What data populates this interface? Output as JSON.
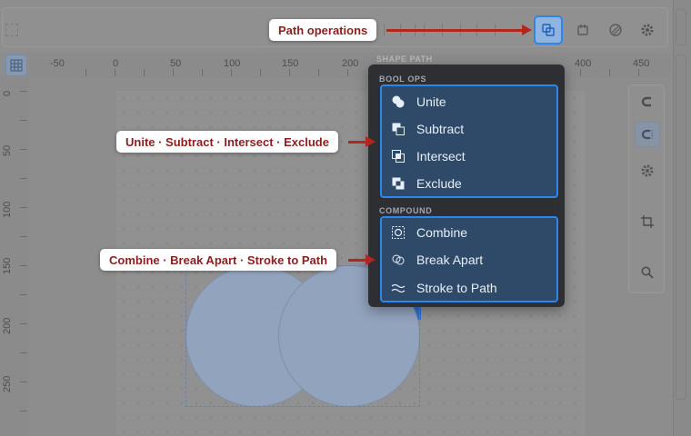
{
  "toolbar": {
    "path_ops_button": {
      "icon": "path-ops-icon",
      "active": true
    },
    "buttons": [
      {
        "icon": "boolean-icon"
      },
      {
        "icon": "image-trace-icon"
      },
      {
        "icon": "gear-icon"
      }
    ]
  },
  "rulers": {
    "horizontal": [
      "-50",
      "0",
      "50",
      "100",
      "150",
      "200",
      "400",
      "450"
    ],
    "vertical": [
      "0",
      "50",
      "100",
      "150",
      "200",
      "250"
    ]
  },
  "menu": {
    "header": "SHAPE PATH",
    "sections": [
      {
        "title": "BOOL OPS",
        "items": [
          {
            "label": "Unite",
            "icon": "unite-icon"
          },
          {
            "label": "Subtract",
            "icon": "subtract-icon"
          },
          {
            "label": "Intersect",
            "icon": "intersect-icon"
          },
          {
            "label": "Exclude",
            "icon": "exclude-icon"
          }
        ]
      },
      {
        "title": "COMPOUND",
        "items": [
          {
            "label": "Combine",
            "icon": "combine-icon"
          },
          {
            "label": "Break Apart",
            "icon": "break-apart-icon"
          },
          {
            "label": "Stroke to Path",
            "icon": "stroke-to-path-icon"
          }
        ]
      }
    ]
  },
  "callouts": {
    "path_operations": "Path operations",
    "bool_ops": "Unite · Subtract · Intersect · Exclude",
    "compound": "Combine · Break Apart · Stroke to Path"
  },
  "right_tools": [
    "magnet-icon",
    "snap-icon",
    "gear-icon",
    "crop-icon",
    "search-icon"
  ],
  "colors": {
    "accent": "#2b86ee",
    "callout_text": "#8e1d1d",
    "arrow": "#b3261e",
    "menu_bg": "#2d2f33",
    "group_bg": "#2f4a68"
  }
}
